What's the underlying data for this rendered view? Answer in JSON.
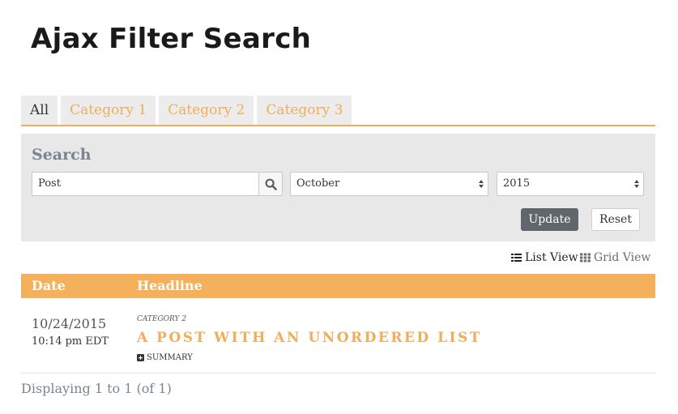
{
  "page": {
    "title": "Ajax Filter Search"
  },
  "tabs": [
    {
      "label": "All",
      "active": true
    },
    {
      "label": "Category 1",
      "active": false
    },
    {
      "label": "Category 2",
      "active": false
    },
    {
      "label": "Category 3",
      "active": false
    }
  ],
  "search": {
    "heading": "Search",
    "query_value": "Post",
    "month_value": "October",
    "year_value": "2015",
    "update_label": "Update",
    "reset_label": "Reset"
  },
  "views": {
    "list_label": "List View",
    "grid_label": "Grid View"
  },
  "table": {
    "headers": {
      "date": "Date",
      "headline": "Headline"
    },
    "rows": [
      {
        "date": "10/24/2015",
        "time": "10:14 pm EDT",
        "category": "Category 2",
        "headline": "A Post With An Unordered List",
        "summary_label": "Summary"
      }
    ]
  },
  "footer": {
    "count_text": "Displaying 1 to 1 (of 1)"
  },
  "colors": {
    "accent": "#f5b05c",
    "update_button": "#61666c",
    "panel": "#e8e8e8"
  },
  "icons": {
    "search": "search-icon",
    "list": "list-icon",
    "grid": "grid-icon",
    "summary": "plus-square-icon"
  }
}
